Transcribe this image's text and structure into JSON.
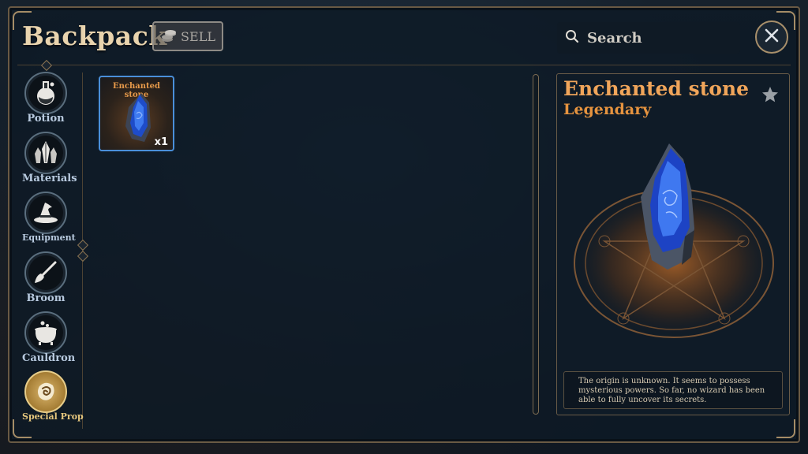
{
  "header": {
    "title": "Backpack",
    "sell_label": "SELL",
    "search_placeholder": "Search"
  },
  "categories": [
    {
      "label": "Potion",
      "icon": "potion-icon"
    },
    {
      "label": "Materials",
      "icon": "crystals-icon"
    },
    {
      "label": "Equipment",
      "icon": "wizard-hat-icon"
    },
    {
      "label": "Broom",
      "icon": "broom-icon"
    },
    {
      "label": "Cauldron",
      "icon": "cauldron-icon"
    },
    {
      "label": "Special Prop",
      "icon": "special-prop-icon",
      "active": true
    }
  ],
  "inventory": [
    {
      "name": "Enchanted stone",
      "count": "x1",
      "selected": true
    }
  ],
  "detail": {
    "name": "Enchanted stone",
    "rarity": "Legendary",
    "description": "The origin is unknown. It seems to possess mysterious powers. So far, no wizard has been able to fully uncover its secrets."
  },
  "colors": {
    "accent_orange": "#f0a55a",
    "selection_blue": "#4a8fd9",
    "frame_gold": "#a58c66"
  }
}
